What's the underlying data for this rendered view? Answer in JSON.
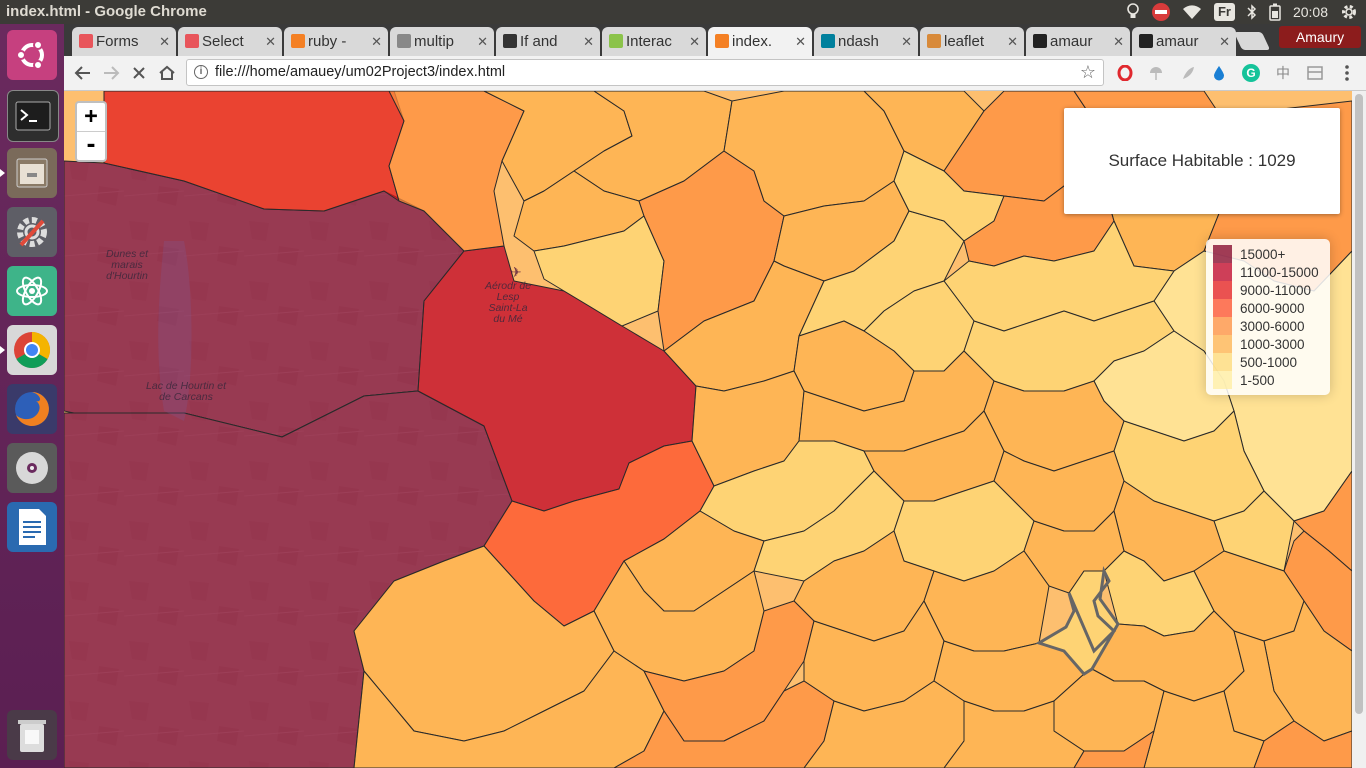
{
  "window": {
    "title": "index.html - Google Chrome"
  },
  "system_tray": {
    "keyboard_layout": "Fr",
    "time": "20:08"
  },
  "tabs": [
    {
      "label": "Forms",
      "favicon_color": "#e8555b"
    },
    {
      "label": "Select",
      "favicon_color": "#e8555b"
    },
    {
      "label": "ruby -",
      "favicon_color": "#f48024"
    },
    {
      "label": "multip",
      "favicon_color": "#888888"
    },
    {
      "label": "If and",
      "favicon_color": "#333333"
    },
    {
      "label": "Interac",
      "favicon_color": "#8bc34a"
    },
    {
      "label": "index.",
      "favicon_color": "#f48024",
      "active": true
    },
    {
      "label": "ndash",
      "favicon_color": "#00809d"
    },
    {
      "label": "leaflet",
      "favicon_color": "#d88a3a"
    },
    {
      "label": "amaur",
      "favicon_color": "#222222"
    },
    {
      "label": "amaur",
      "favicon_color": "#222222"
    }
  ],
  "profile": {
    "name": "Amaury"
  },
  "address_bar": {
    "url": "file:///home/amauey/um02Project3/index.html"
  },
  "map": {
    "zoom_in_label": "+",
    "zoom_out_label": "-",
    "info": {
      "label": "Surface Habitable",
      "value": "1029",
      "text": "Surface Habitable : 1029"
    },
    "legend": [
      {
        "label": "15000+",
        "color": "#800026"
      },
      {
        "label": "11000-15000",
        "color": "#bd0026"
      },
      {
        "label": "9000-11000",
        "color": "#e31a1c"
      },
      {
        "label": "6000-9000",
        "color": "#fc4e2a"
      },
      {
        "label": "3000-6000",
        "color": "#fd8d3c"
      },
      {
        "label": "1000-3000",
        "color": "#feb24c"
      },
      {
        "label": "500-1000",
        "color": "#fed976"
      },
      {
        "label": "1-500",
        "color": "#ffeda0"
      }
    ],
    "place_labels": {
      "dunes": "Dunes et marais d'Hourtin",
      "lac": "Lac de Hourtin et de Carcans",
      "aerodrome": "Aérodr de Lesp Saint-La du Mé"
    }
  }
}
